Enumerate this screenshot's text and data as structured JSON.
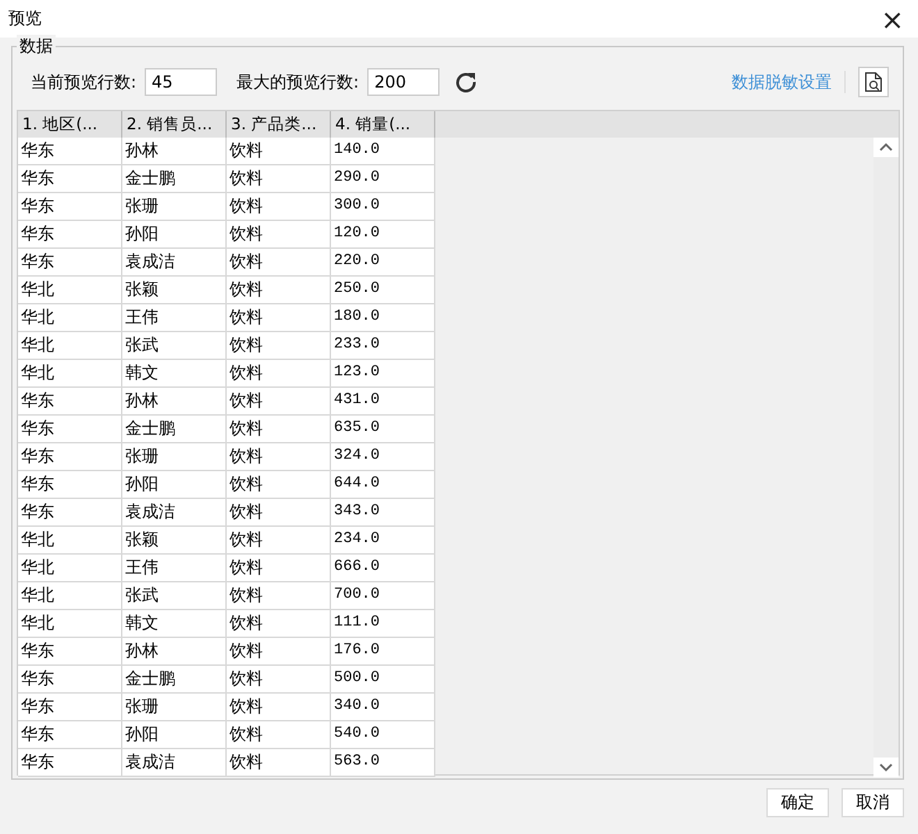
{
  "window": {
    "title": "预览",
    "close": "×"
  },
  "group": {
    "title": "数据"
  },
  "toolbar": {
    "current_rows_label": "当前预览行数:",
    "current_rows_value": "45",
    "max_rows_label": "最大的预览行数:",
    "max_rows_value": "200",
    "mask_link": "数据脱敏设置"
  },
  "table": {
    "columns": [
      "1. 地区(...",
      "2. 销售员...",
      "3. 产品类...",
      "4. 销量(..."
    ],
    "rows": [
      [
        "华东",
        "孙林",
        "饮料",
        "140.0"
      ],
      [
        "华东",
        "金士鹏",
        "饮料",
        "290.0"
      ],
      [
        "华东",
        "张珊",
        "饮料",
        "300.0"
      ],
      [
        "华东",
        "孙阳",
        "饮料",
        "120.0"
      ],
      [
        "华东",
        "袁成洁",
        "饮料",
        "220.0"
      ],
      [
        "华北",
        "张颖",
        "饮料",
        "250.0"
      ],
      [
        "华北",
        "王伟",
        "饮料",
        "180.0"
      ],
      [
        "华北",
        "张武",
        "饮料",
        "233.0"
      ],
      [
        "华北",
        "韩文",
        "饮料",
        "123.0"
      ],
      [
        "华东",
        "孙林",
        "饮料",
        "431.0"
      ],
      [
        "华东",
        "金士鹏",
        "饮料",
        "635.0"
      ],
      [
        "华东",
        "张珊",
        "饮料",
        "324.0"
      ],
      [
        "华东",
        "孙阳",
        "饮料",
        "644.0"
      ],
      [
        "华东",
        "袁成洁",
        "饮料",
        "343.0"
      ],
      [
        "华北",
        "张颖",
        "饮料",
        "234.0"
      ],
      [
        "华北",
        "王伟",
        "饮料",
        "666.0"
      ],
      [
        "华北",
        "张武",
        "饮料",
        "700.0"
      ],
      [
        "华北",
        "韩文",
        "饮料",
        "111.0"
      ],
      [
        "华东",
        "孙林",
        "饮料",
        "176.0"
      ],
      [
        "华东",
        "金士鹏",
        "饮料",
        "500.0"
      ],
      [
        "华东",
        "张珊",
        "饮料",
        "340.0"
      ],
      [
        "华东",
        "孙阳",
        "饮料",
        "540.0"
      ],
      [
        "华东",
        "袁成洁",
        "饮料",
        "563.0"
      ]
    ]
  },
  "buttons": [
    "确定",
    "取消"
  ]
}
